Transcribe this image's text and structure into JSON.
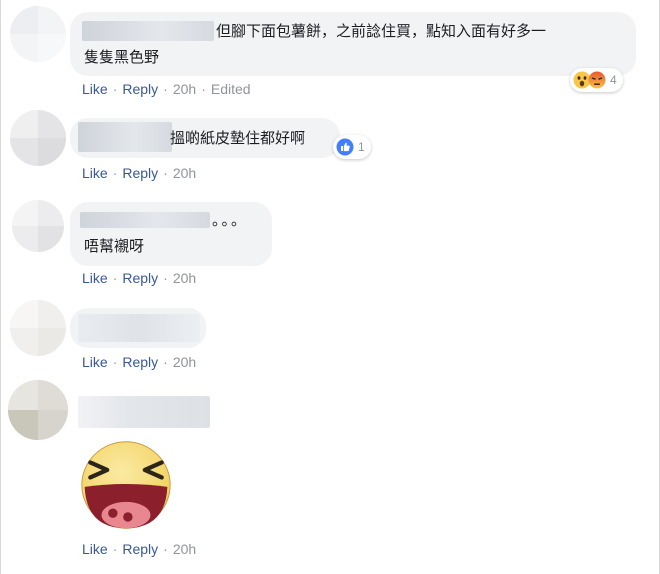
{
  "comments": [
    {
      "text_line1": "但腳下面包薯餅，之前諗住買，點知入面有好多一",
      "text_line2": "隻隻黑色野",
      "actions": {
        "like": "Like",
        "reply": "Reply",
        "time": "20h",
        "edited": "Edited"
      },
      "reactions": {
        "icons": [
          "wow-icon",
          "angry-icon"
        ],
        "count": "4"
      }
    },
    {
      "text": "搵啲紙皮墊住都好啊",
      "actions": {
        "like": "Like",
        "reply": "Reply",
        "time": "20h"
      },
      "reactions": {
        "icons": [
          "like-icon"
        ],
        "count": "1"
      }
    },
    {
      "name_suffix": "。。。",
      "text": "唔幫襯呀",
      "actions": {
        "like": "Like",
        "reply": "Reply",
        "time": "20h"
      }
    },
    {
      "actions": {
        "like": "Like",
        "reply": "Reply",
        "time": "20h"
      }
    },
    {
      "sticker": "laughing-face-sticker",
      "actions": {
        "like": "Like",
        "reply": "Reply",
        "time": "20h"
      }
    }
  ],
  "colors": {
    "bubble": "#f2f3f5",
    "link": "#385898",
    "meta": "#90949c",
    "like_blue": "#4080ff",
    "sticker_yellow": "#f5dc7a"
  }
}
